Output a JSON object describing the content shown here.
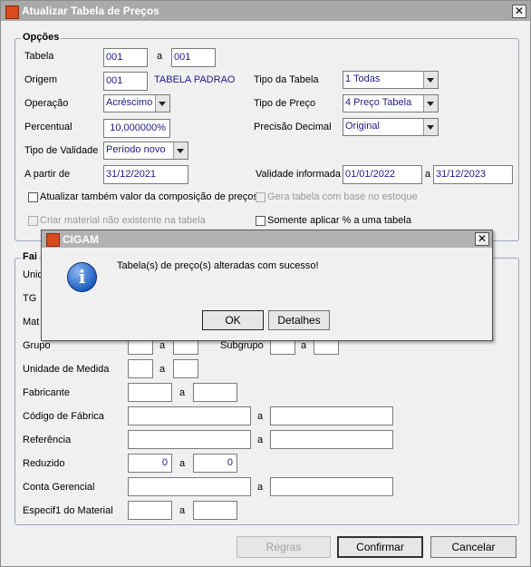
{
  "window": {
    "title": "Atualizar Tabela de Preços",
    "close": "✕"
  },
  "opcoes": {
    "legend": "Opções",
    "tabela_label": "Tabela",
    "tabela_from": "001",
    "tabela_a": "a",
    "tabela_to": "001",
    "origem_label": "Origem",
    "origem_value": "001",
    "origem_desc": "TABELA PADRAO",
    "tipo_tabela_label": "Tipo da Tabela",
    "tipo_tabela_value": "1 Todas",
    "operacao_label": "Operação",
    "operacao_value": "Acréscimo",
    "tipo_preco_label": "Tipo de Preço",
    "tipo_preco_value": "4 Preço Tabela",
    "percentual_label": "Percentual",
    "percentual_value": "10,000000%",
    "precisao_label": "Precisão Decimal",
    "precisao_value": "Original",
    "validade_label": "Tipo de Validade",
    "validade_value": "Período novo",
    "apartir_label": "A partir de",
    "apartir_value": "31/12/2021",
    "validade_inf_label": "Validade informada",
    "validade_from": "01/01/2022",
    "validade_a": "a",
    "validade_to": "31/12/2023",
    "chk_atualizar": "Atualizar também valor da composição de preços",
    "chk_gera": "Gera tabela com base no estoque",
    "chk_criar": "Criar material não existente na tabela",
    "chk_somente": "Somente aplicar % a uma tabela"
  },
  "faixas": {
    "legend": "Fai",
    "unid_label": "Unid",
    "tg_label": "TG",
    "mat_label": "Mat",
    "grupo_label": "Grupo",
    "subgrupo_label": "Subgrupo",
    "unidade_label": "Unidade de Medida",
    "fabricante_label": "Fabricante",
    "codigo_label": "Código de Fábrica",
    "referencia_label": "Referência",
    "reduzido_label": "Reduzido",
    "reduzido_from": "0",
    "reduzido_to": "0",
    "conta_label": "Conta Gerencial",
    "especif_label": "Especif1 do Material",
    "a": "a"
  },
  "buttons": {
    "regras": "Regras",
    "confirmar": "Confirmar",
    "cancelar": "Cancelar"
  },
  "dialog": {
    "title": "CIGAM",
    "message": "Tabela(s) de preço(s) alteradas com sucesso!",
    "ok": "OK",
    "detalhes": "Detalhes",
    "icon": "information-icon"
  }
}
